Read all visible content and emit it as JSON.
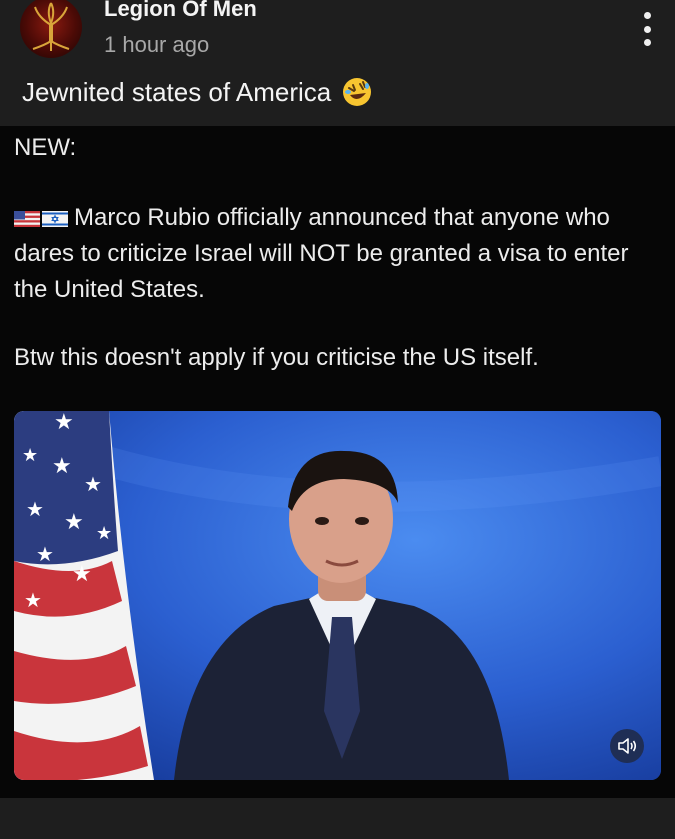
{
  "post": {
    "author": "Legion Of Men",
    "time": "1 hour ago",
    "caption": "Jewnited states of America",
    "caption_emoji": "rolling-on-floor-laughing-emoji"
  },
  "shared": {
    "new_label": "NEW:",
    "flag_icons": [
      "us-flag-icon",
      "israel-flag-icon"
    ],
    "announcement": "Marco Rubio officially announced that anyone who dares to criticize Israel will NOT be granted a visa to enter the United States.",
    "btw": "Btw this doesn't apply if you criticise the US itself."
  },
  "video": {
    "icon": "speaker-icon"
  },
  "colors": {
    "background": "#1e1e1e",
    "post_background": "#060606",
    "video_blue": "#2456c8"
  }
}
